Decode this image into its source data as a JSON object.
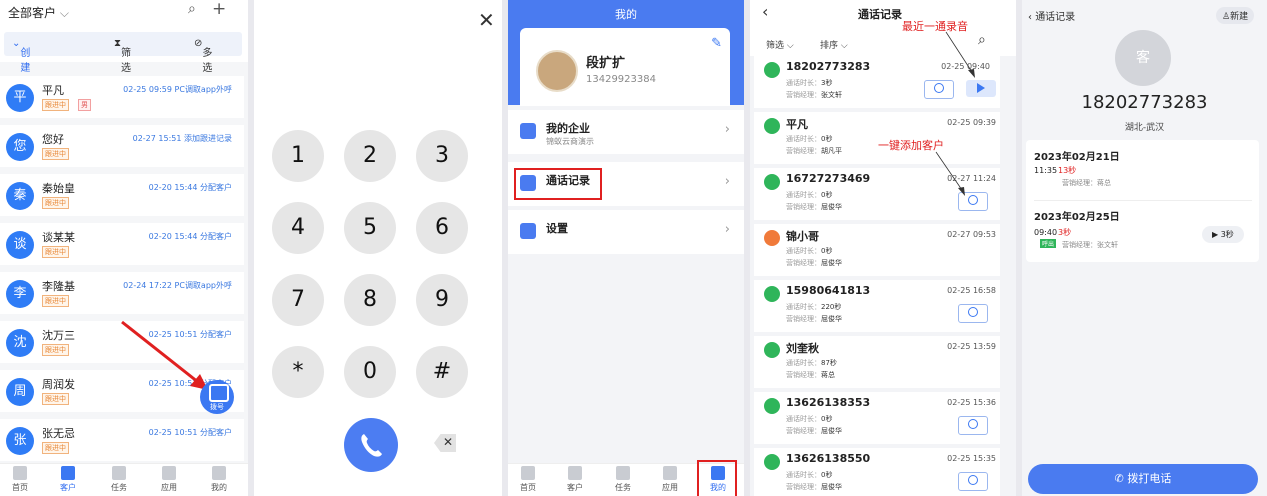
{
  "colors": {
    "accent": "#3b78f2",
    "green": "#2fb55a",
    "orange": "#f07a3a",
    "red": "#e02020"
  },
  "panel1": {
    "title": "全部客户",
    "filters": {
      "sort": "创建时间",
      "filter": "筛选",
      "multi": "多选"
    },
    "customers": [
      {
        "avatar": "平",
        "name": "平凡",
        "tag": "跟进中",
        "gender": "男",
        "info": "02-25 09:59 PC调取app外呼"
      },
      {
        "avatar": "您",
        "name": "您好",
        "tag": "跟进中",
        "info": "02-27 15:51 添加跟进记录"
      },
      {
        "avatar": "秦",
        "name": "秦始皇",
        "tag": "跟进中",
        "info": "02-20 15:44 分配客户"
      },
      {
        "avatar": "谈",
        "name": "谈某某",
        "tag": "跟进中",
        "info": "02-20 15:44 分配客户"
      },
      {
        "avatar": "李",
        "name": "李隆基",
        "tag": "跟进中",
        "info": "02-24 17:22 PC调取app外呼"
      },
      {
        "avatar": "沈",
        "name": "沈万三",
        "tag": "跟进中",
        "info": "02-25 10:51 分配客户"
      },
      {
        "avatar": "周",
        "name": "周润发",
        "tag": "跟进中",
        "info": "02-25 10:51 分配客户"
      },
      {
        "avatar": "张",
        "name": "张无忌",
        "tag": "跟进中",
        "info": "02-25 10:51 分配客户"
      }
    ],
    "fab": "拨号",
    "tabs": [
      "首页",
      "客户",
      "任务",
      "应用",
      "我的"
    ]
  },
  "panel2": {
    "keys": [
      "1",
      "2",
      "3",
      "4",
      "5",
      "6",
      "7",
      "8",
      "9",
      "*",
      "0",
      "#"
    ]
  },
  "panel3": {
    "header": "我的",
    "user_name": "段扩扩",
    "user_phone": "13429923384",
    "menu": [
      {
        "label": "我的企业",
        "sub": "锦蚁云商演示"
      },
      {
        "label": "通话记录",
        "sub": ""
      },
      {
        "label": "设置",
        "sub": ""
      }
    ],
    "tabs": [
      "首页",
      "客户",
      "任务",
      "应用",
      "我的"
    ]
  },
  "panel4": {
    "title": "通话记录",
    "filter": "筛选",
    "sort": "排序",
    "anno1": "最近一通录音",
    "anno2": "一键添加客户",
    "duration_label": "通话时长：",
    "manager_label": "营销经理：",
    "records": [
      {
        "number": "18202773283",
        "time": "02-25 09:40",
        "duration": "3秒",
        "manager": "张文轩",
        "play": true,
        "user": true,
        "type": "out"
      },
      {
        "number": "平凡",
        "time": "02-25 09:39",
        "duration": "0秒",
        "manager": "胡凡平",
        "play": false,
        "user": false,
        "type": "out"
      },
      {
        "number": "16727273469",
        "time": "02-27 11:24",
        "duration": "0秒",
        "manager": "屈俊华",
        "play": false,
        "user": true,
        "type": "out"
      },
      {
        "number": "锦小哥",
        "time": "02-27 09:53",
        "duration": "0秒",
        "manager": "屈俊华",
        "play": false,
        "user": false,
        "type": "in"
      },
      {
        "number": "15980641813",
        "time": "02-25 16:58",
        "duration": "220秒",
        "manager": "屈俊华",
        "play": false,
        "user": true,
        "type": "out"
      },
      {
        "number": "刘奎秋",
        "time": "02-25 13:59",
        "duration": "87秒",
        "manager": "蒋总",
        "play": false,
        "user": false,
        "type": "out"
      },
      {
        "number": "13626138353",
        "time": "02-25 15:36",
        "duration": "0秒",
        "manager": "屈俊华",
        "play": false,
        "user": true,
        "type": "out"
      },
      {
        "number": "13626138550",
        "time": "02-25 15:35",
        "duration": "0秒",
        "manager": "屈俊华",
        "play": false,
        "user": true,
        "type": "out"
      }
    ]
  },
  "panel5": {
    "back": "通话记录",
    "new": "新建",
    "avatar": "客",
    "number": "18202773283",
    "location": "湖北-武汉",
    "days": [
      {
        "date": "2023年02月21日",
        "time": "11:35",
        "duration": "13秒",
        "badge": "",
        "manager": "营销经理：蒋总",
        "play": ""
      },
      {
        "date": "2023年02月25日",
        "time": "09:40",
        "duration": "3秒",
        "badge": "呼出",
        "manager": "营销经理：张文轩",
        "play": "3秒"
      }
    ],
    "call_btn": "拨打电话"
  }
}
